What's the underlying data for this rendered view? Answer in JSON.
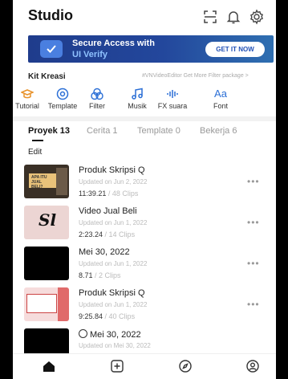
{
  "header": {
    "title": "Studio"
  },
  "banner": {
    "title": "Secure Access with",
    "subtitle": "UI Verify",
    "button": "GET IT NOW"
  },
  "kit": {
    "title": "Kit Kreasi",
    "note": "#VNVideoEditor Get More Filter package >",
    "tools": [
      {
        "label": "Tutorial",
        "icon": "graduation-cap-icon"
      },
      {
        "label": "Template",
        "icon": "template-circle-icon"
      },
      {
        "label": "Filter",
        "icon": "filter-circles-icon"
      },
      {
        "label": "Musik",
        "icon": "music-note-icon"
      },
      {
        "label": "FX suara",
        "icon": "sound-wave-icon"
      },
      {
        "label": "Font",
        "icon": "font-aa-icon"
      }
    ]
  },
  "tabs": [
    {
      "label": "Proyek 13"
    },
    {
      "label": "Cerita 1"
    },
    {
      "label": "Template 0"
    },
    {
      "label": "Bekerja 6"
    }
  ],
  "edit_label": "Edit",
  "projects": [
    {
      "name": "Produk Skripsi Q",
      "updated": "Updated on Jun 2, 2022",
      "duration": "11:39.21",
      "clips": "/ 48 Clips",
      "thumb_text": "APA ITU JUAL BELI?"
    },
    {
      "name": "Video Jual Beli",
      "updated": "Updated on Jun 1, 2022",
      "duration": "2:23.24",
      "clips": "/ 14 Clips",
      "thumb_text": "Sl"
    },
    {
      "name": "Mei 30, 2022",
      "updated": "Updated on Jun 1, 2022",
      "duration": "8.71",
      "clips": "/ 2 Clips",
      "thumb_text": ""
    },
    {
      "name": "Produk Skripsi Q",
      "updated": "Updated on Jun 1, 2022",
      "duration": "9:25.84",
      "clips": "/ 40 Clips",
      "thumb_text": ""
    },
    {
      "name": "Mei 30, 2022",
      "updated": "Updated on Mei 30, 2022",
      "duration": "",
      "clips": "",
      "thumb_text": ""
    }
  ],
  "more_label": "•••",
  "colors": {
    "accent": "#1f3c8c",
    "accent_light": "#8fc2ff",
    "icon_orange": "#e8922a",
    "icon_blue": "#2b6fd6"
  }
}
